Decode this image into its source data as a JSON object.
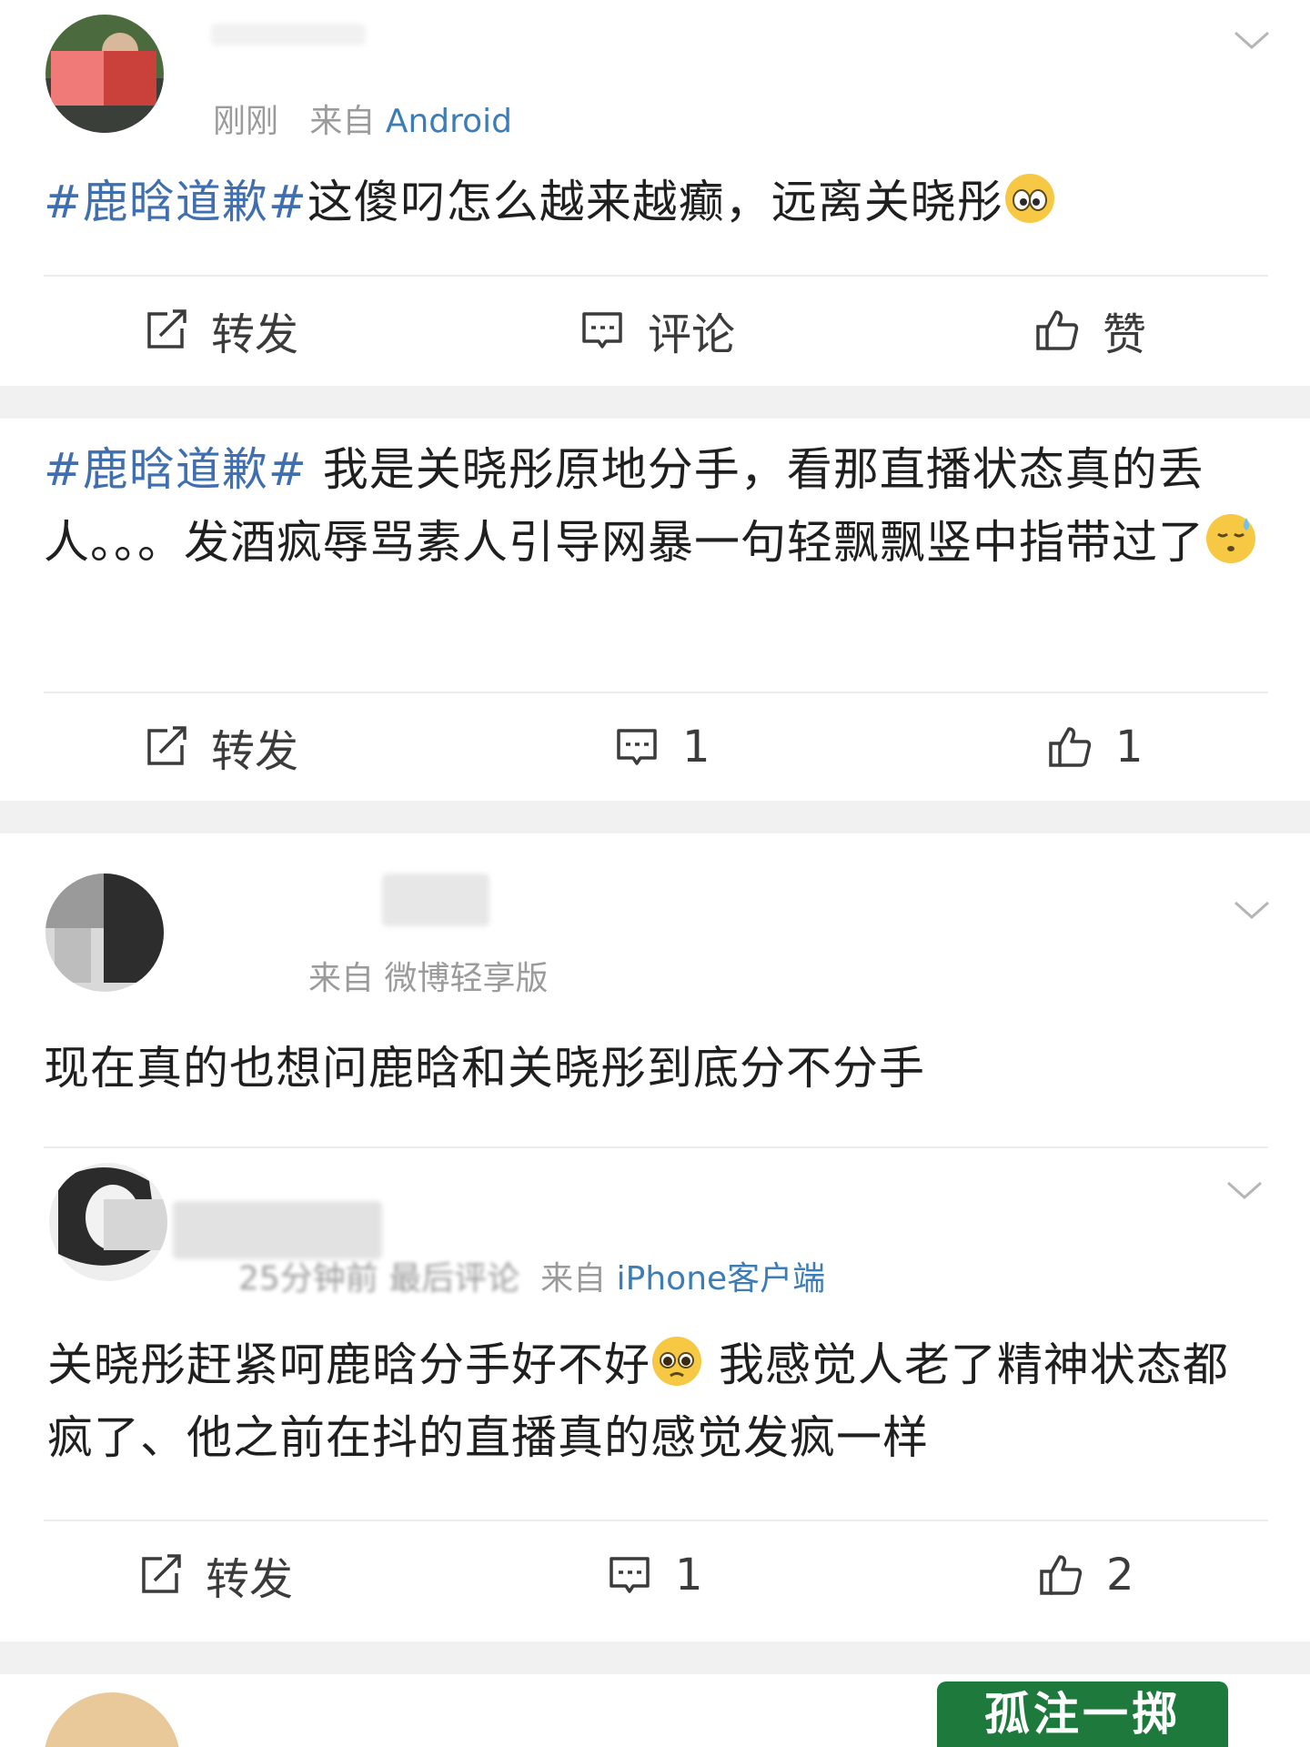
{
  "posts": [
    {
      "username": "",
      "time": "刚刚",
      "source_prefix": "来自",
      "source_device": "Android",
      "hashtag": "#鹿晗道歉#",
      "text": "这傻叼怎么越来越癫，远离关晓彤",
      "emoji": "eyes-emoji",
      "actions": {
        "repost": "转发",
        "comment": "评论",
        "like": "赞"
      }
    },
    {
      "hashtag": "#鹿晗道歉#",
      "text": " 我是关晓彤原地分手，看那直播状态真的丢人。。。发酒疯辱骂素人引导网暴一句轻飘飘竖中指带过了",
      "emoji": "sweat-face-emoji",
      "actions": {
        "repost": "转发",
        "comment": "1",
        "like": "1"
      }
    },
    {
      "username": "",
      "source_prefix": "来自",
      "source_device": "微博轻享版",
      "text": "现在真的也想问鹿晗和关晓彤到底分不分手"
    },
    {
      "username": "",
      "time": "25分钟前",
      "last_comment": "最后评论",
      "source_prefix": "来自",
      "source_device": "iPhone客户端",
      "text_before_emoji": "关晓彤赶紧呵鹿晗分手好不好",
      "text_after_emoji": " 我感觉人老了精神状态都疯了、他之前在抖的直播真的感觉发疯一样",
      "emoji": "pleading-face-emoji",
      "actions": {
        "repost": "转发",
        "comment": "1",
        "like": "2"
      }
    }
  ],
  "partial_card": {
    "badge": "孤注一掷"
  },
  "colors": {
    "hashtag": "#3f6fb0",
    "device_link": "#3c7db8",
    "meta_gray": "#9b9b9b",
    "page_bg": "#f1f1f1",
    "card_bg": "#ffffff"
  },
  "icons": {
    "repost": "repost-icon",
    "comment": "comment-icon",
    "like": "thumbs-up-icon",
    "menu": "chevron-down-icon"
  }
}
